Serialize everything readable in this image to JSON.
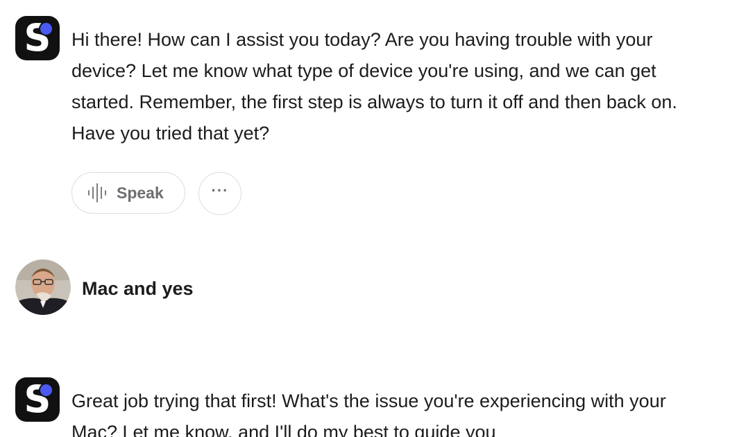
{
  "conversation": {
    "bot_message_1": {
      "avatar_letter": "S",
      "text": "Hi there! How can I assist you today? Are you having trouble with your device? Let me know what type of device you're using, and we can get started. Remember, the first step is always to turn it off and then back on. Have you tried that yet?",
      "actions": {
        "speak_label": "Speak",
        "speak_icon": "sound-wave-icon",
        "more_label": "···",
        "more_icon": "more-options-icon"
      }
    },
    "user_message": {
      "avatar_icon": "user-avatar-photo",
      "text": "Mac and yes"
    },
    "bot_message_2": {
      "avatar_letter": "S",
      "text": "Great job trying that first! What's the issue you're experiencing with your Mac? Let me know, and I'll do my best to guide you"
    }
  },
  "colors": {
    "bot_avatar_bg": "#111111",
    "bot_avatar_dot": "#4a5af2",
    "text": "#1c1c1e",
    "button_text": "#6d6d73",
    "button_border": "#dcdce0"
  }
}
